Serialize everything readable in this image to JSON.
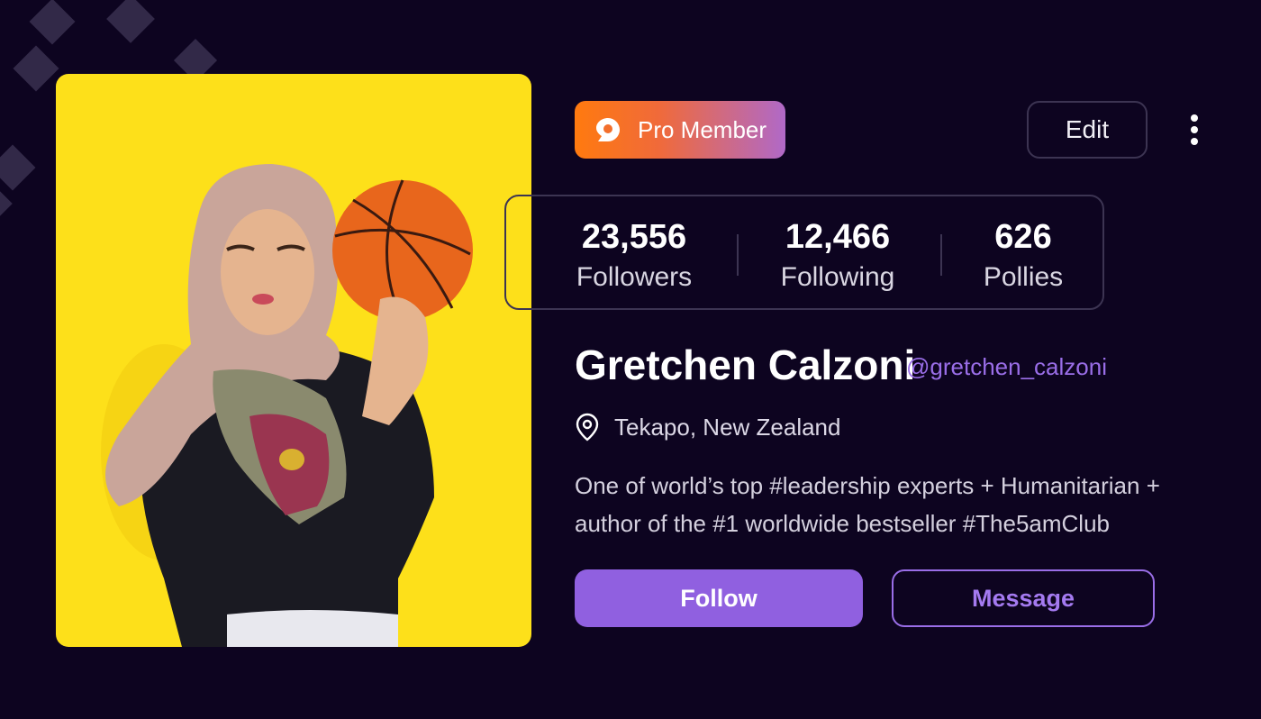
{
  "badge": {
    "label": "Pro Member",
    "icon": "pro-logo-icon"
  },
  "header": {
    "edit_label": "Edit",
    "more_icon": "more-vertical-icon"
  },
  "stats": [
    {
      "value": "23,556",
      "label": "Followers"
    },
    {
      "value": "12,466",
      "label": "Following"
    },
    {
      "value": "626",
      "label": "Pollies"
    }
  ],
  "profile": {
    "name": "Gretchen Calzoni",
    "handle": "@gretchen_calzoni",
    "location": "Tekapo, New Zealand",
    "location_icon": "map-pin-icon",
    "bio": "One of world’s top #leadership experts + Humanitarian + author of the #1 worldwide bestseller #The5amClub"
  },
  "actions": {
    "follow_label": "Follow",
    "message_label": "Message"
  },
  "colors": {
    "background": "#0d0420",
    "accent": "#9060e0",
    "photo_bg": "#fde01a",
    "badge_gradient_start": "#ff7a0f",
    "badge_gradient_end": "#b069c8"
  }
}
